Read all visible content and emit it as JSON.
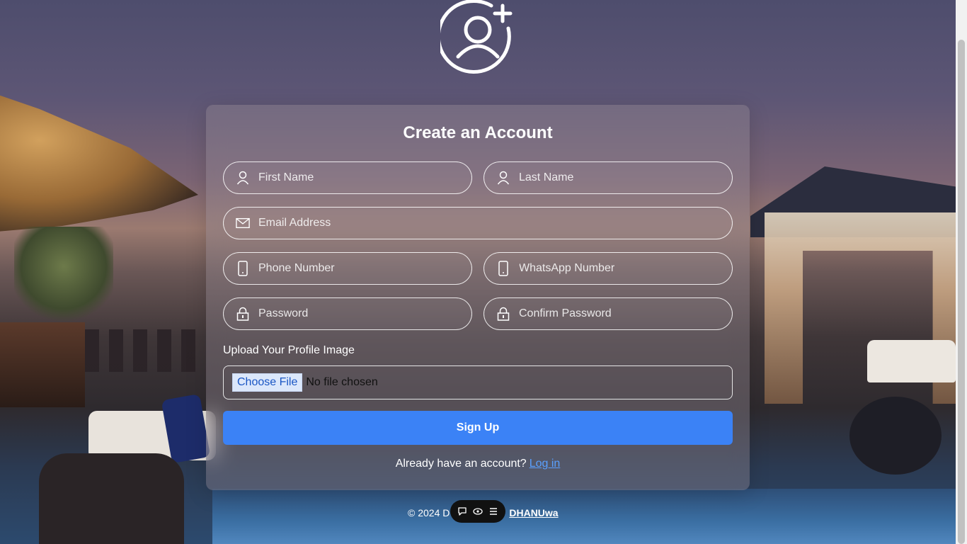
{
  "form": {
    "title": "Create an Account",
    "first_name_placeholder": "First Name",
    "last_name_placeholder": "Last Name",
    "email_placeholder": "Email Address",
    "phone_placeholder": "Phone Number",
    "whatsapp_placeholder": "WhatsApp Number",
    "password_placeholder": "Password",
    "confirm_password_placeholder": "Confirm Password",
    "upload_label": "Upload Your Profile Image",
    "choose_file_label": "Choose File",
    "no_file_text": "No file chosen",
    "submit_label": "Sign Up",
    "login_prompt": "Already have an account?",
    "login_link": "Log in"
  },
  "footer": {
    "copyright_prefix": "© 2024 D",
    "author_link": "DHANUwa"
  },
  "icons": {
    "avatar": "add-user-icon",
    "name": "user-icon",
    "email": "envelope-icon",
    "phone": "mobile-phone-icon",
    "password": "lock-icon",
    "toolbar": [
      "chat-icon",
      "eye-icon",
      "menu-icon"
    ]
  },
  "colors": {
    "primary_button": "#3b82f6",
    "link": "#5aa0ff",
    "text": "#ffffff"
  }
}
